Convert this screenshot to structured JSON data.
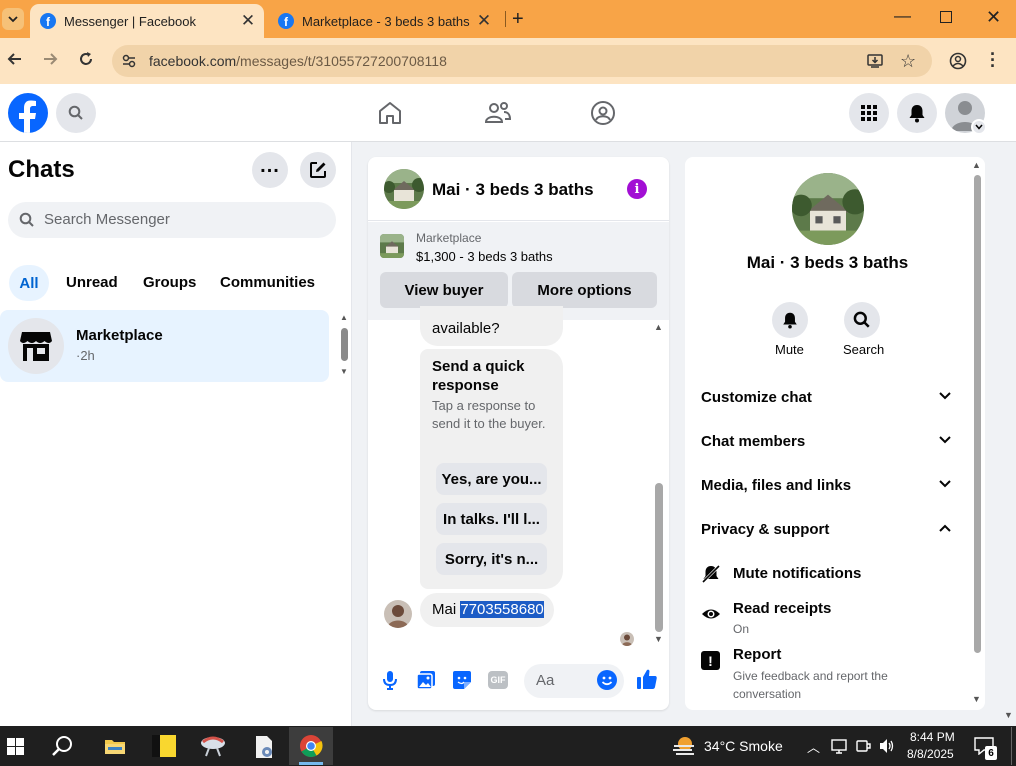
{
  "browser": {
    "tabs": [
      {
        "title": "Messenger | Facebook",
        "active": true
      },
      {
        "title": "Marketplace - 3 beds 3 baths | F",
        "active": false
      }
    ],
    "url_host": "facebook.com",
    "url_path": "/messages/t/31055727200708118",
    "colors": {
      "frame": "#f8a447",
      "toolbar": "#fde4c2"
    }
  },
  "sidebar": {
    "title": "Chats",
    "search_placeholder": "Search Messenger",
    "filters": [
      "All",
      "Unread",
      "Groups",
      "Communities"
    ],
    "chats": [
      {
        "name": "Marketplace",
        "time": "·2h"
      }
    ]
  },
  "conversation": {
    "title": "Mai · 3 beds 3 baths",
    "marketplace": {
      "label": "Marketplace",
      "price": "$1,300 - 3 beds 3 baths"
    },
    "buttons": {
      "view_buyer": "View buyer",
      "more_options": "More options"
    },
    "partial_message": "available?",
    "quick_title": "Send a quick response",
    "quick_subtitle": "Tap a response to send it to the buyer.",
    "quick_replies": [
      "Yes, are you...",
      "In talks. I'll l...",
      "Sorry, it's n..."
    ],
    "last_message": {
      "prefix": "Mai ",
      "highlighted": "7703558680"
    },
    "input_placeholder": "Aa"
  },
  "details": {
    "title": "Mai · 3 beds 3 baths",
    "actions": [
      "Mute",
      "Search"
    ],
    "sections": [
      "Customize chat",
      "Chat members",
      "Media, files and links",
      "Privacy & support"
    ],
    "privacy_items": [
      {
        "title": "Mute notifications",
        "subtitle": ""
      },
      {
        "title": "Read receipts",
        "subtitle": "On"
      },
      {
        "title": "Report",
        "subtitle": "Give feedback and report the conversation"
      }
    ]
  },
  "taskbar": {
    "weather": "34°C  Smoke",
    "time": "8:44 PM",
    "date": "8/8/2025",
    "notification_count": "6"
  },
  "colors": {
    "accent": "#0866ff",
    "selected_bg": "#e7f3ff",
    "highlight": "#1c5cc6"
  }
}
